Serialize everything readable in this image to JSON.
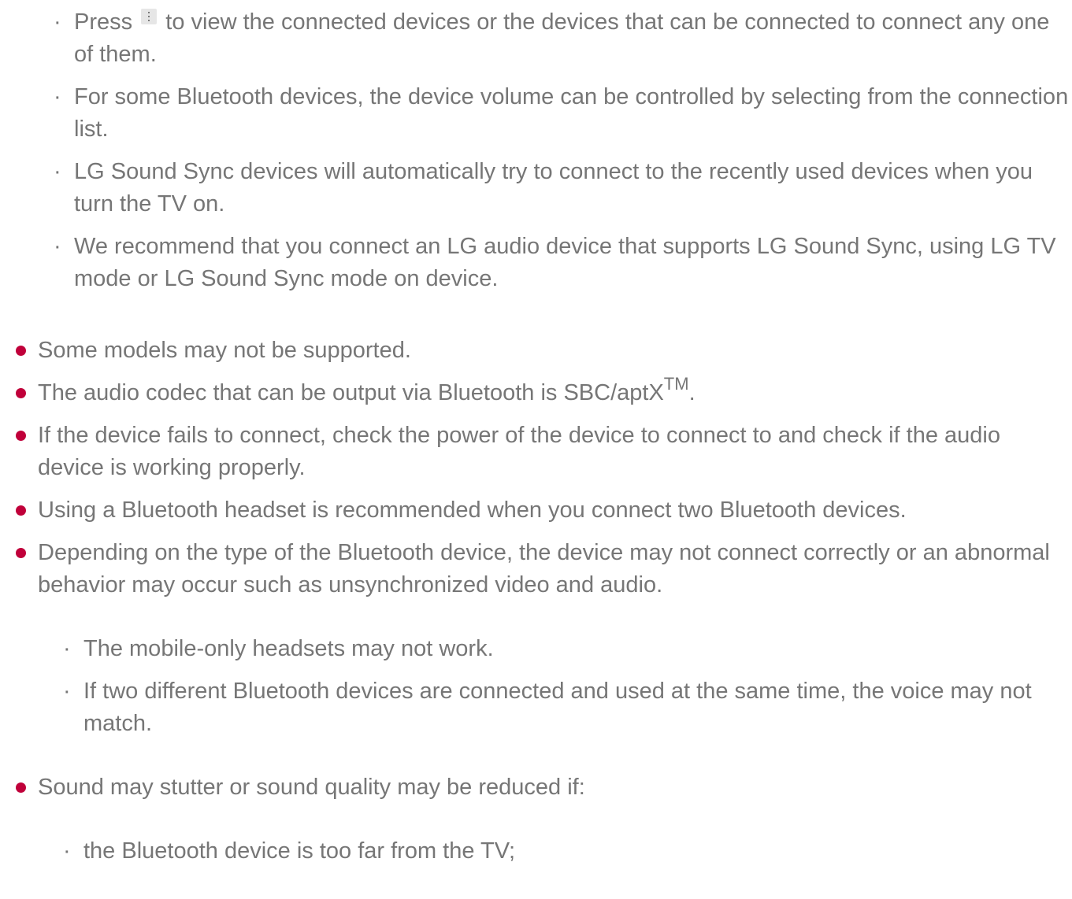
{
  "top_sub_items": [
    {
      "before_icon": "Press",
      "icon": "more-options-icon",
      "after_icon": "to view the connected devices or the devices that can be connected to connect any one of them."
    },
    {
      "text": "For some Bluetooth devices, the device volume can be controlled by selecting from the connection list."
    },
    {
      "text": "LG Sound Sync devices will automatically try to connect to the recently used devices when you turn the TV on."
    },
    {
      "text": "We recommend that you connect an LG audio device that supports LG Sound Sync, using LG TV mode or LG Sound Sync mode on device."
    }
  ],
  "sub_bullet_char": "·",
  "bullet_color": "#c0003a",
  "main_items": [
    {
      "text": "Some models may not be supported."
    },
    {
      "text": "The audio codec that can be output via Bluetooth is SBC/aptX",
      "sup": "TM",
      "suffix": "."
    },
    {
      "text": "If the device fails to connect, check the power of the device to connect to and check if the audio device is working properly."
    },
    {
      "text": "Using a Bluetooth headset is recommended when you connect two Bluetooth devices."
    },
    {
      "text": "Depending on the type of the Bluetooth device, the device may not connect correctly or an abnormal behavior may occur such as unsynchronized video and audio.",
      "sub_items": [
        "The mobile-only headsets may not work.",
        "If two different Bluetooth devices are connected and used at the same time, the voice may not match."
      ]
    },
    {
      "text": "Sound may stutter or sound quality may be reduced if:",
      "sub_items": [
        "the Bluetooth device is too far from the TV;"
      ]
    }
  ]
}
